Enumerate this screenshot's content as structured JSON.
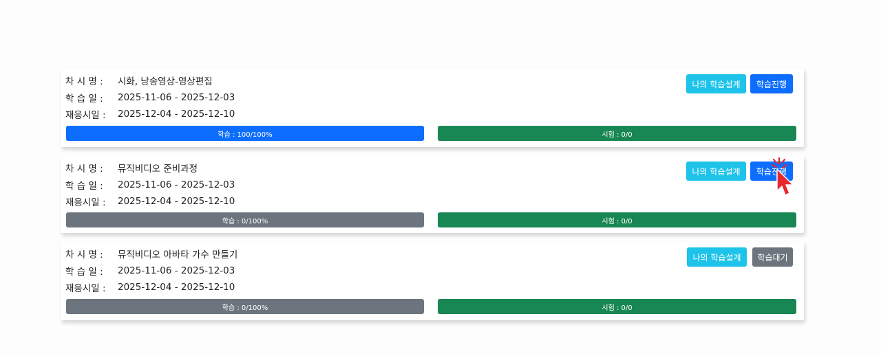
{
  "labels": {
    "session_name": "차 시 명 :",
    "study_date": "학 습 일 :",
    "reuse_period": "재응시일 :"
  },
  "cards": [
    {
      "session_name": "시화, 낭송영상-영상편집",
      "study_date": "2025-11-06 - 2025-12-03",
      "reuse_period": "2025-12-04 - 2025-12-10",
      "design_button": "나의 학습설계",
      "action_button": "학습진행",
      "study_progress_text": "학습 : 100/100%",
      "study_progress_percent": 100,
      "exam_progress_text": "시험 : 0/0",
      "exam_progress_percent": 100
    },
    {
      "session_name": "뮤직비디오 준비과정",
      "study_date": "2025-11-06 - 2025-12-03",
      "reuse_period": "2025-12-04 - 2025-12-10",
      "design_button": "나의 학습설계",
      "action_button": "학습진행",
      "study_progress_text": "학습 : 0/100%",
      "study_progress_percent": 0,
      "exam_progress_text": "시험 : 0/0",
      "exam_progress_percent": 100
    },
    {
      "session_name": "뮤직비디오 아바타 가수 만들기",
      "study_date": "2025-11-06 - 2025-12-03",
      "reuse_period": "2025-12-04 - 2025-12-10",
      "design_button": "나의 학습설계",
      "action_button": "학습대기",
      "study_progress_text": "학습 : 0/100%",
      "study_progress_percent": 0,
      "exam_progress_text": "시험 : 0/0",
      "exam_progress_percent": 100
    }
  ],
  "colors": {
    "design_button": "#1ec3ea",
    "progress_button": "#0d6efd",
    "wait_button": "#6c757d",
    "study_bar_fill": "#0d6efd",
    "study_bar_empty": "#6c757d",
    "exam_bar_fill": "#198754",
    "cursor": "#e8262e"
  }
}
